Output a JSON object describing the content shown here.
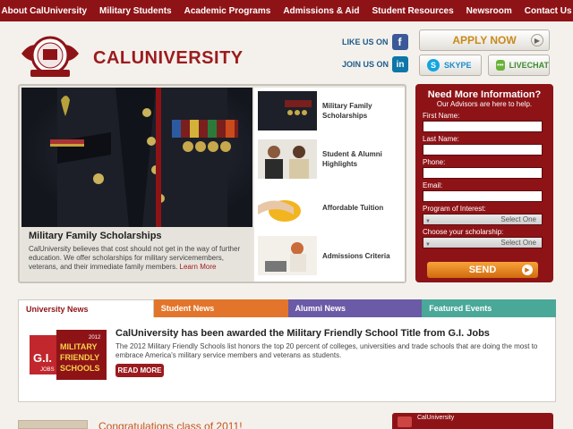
{
  "nav": [
    "About CalUniversity",
    "Military Students",
    "Academic Programs",
    "Admissions & Aid",
    "Student Resources",
    "Newsroom",
    "Contact Us"
  ],
  "brand": "CALUNIVERSITY",
  "social": {
    "facebook": "LIKE US ON",
    "linkedin": "JOIN US ON"
  },
  "buttons": {
    "apply": "APPLY NOW",
    "skype": "SKYPE",
    "livechat": "LIVECHAT"
  },
  "feature": {
    "title": "Military Family Scholarships",
    "text": "CalUniversity believes that cost should not get in the way of further education. We offer scholarships for military servicemembers, veterans, and their immediate family members.",
    "more": "Learn More",
    "items": [
      "Military Family Scholarships",
      "Student & Alumni Highlights",
      "Affordable Tuition",
      "Admissions Criteria"
    ]
  },
  "form": {
    "title": "Need More Information?",
    "subtitle": "Our Advisors are here to help.",
    "first_name": "First Name:",
    "last_name": "Last Name:",
    "phone": "Phone:",
    "email": "Email:",
    "program": "Program of Interest:",
    "scholarship": "Choose your scholarship:",
    "select_one": "Select One",
    "send": "SEND"
  },
  "tabs": [
    "University News",
    "Student News",
    "Alumni News",
    "Featured Events"
  ],
  "news": {
    "title": "CalUniversity has been awarded the Military Friendly School Title from G.I. Jobs",
    "body": "The 2012 Military Friendly Schools list honors the top 20 percent of colleges, universities and trade schools that are doing the most to embrace America's military service members and veterans as students.",
    "read_more": "READ MORE",
    "badge_gi": "G.I.",
    "badge_jobs": "JOBS",
    "badge_year": "2012",
    "badge_line1": "MILITARY",
    "badge_line2": "FRIENDLY",
    "badge_line3": "SCHOOLS"
  },
  "bottom": {
    "congrats": "Congratulations class of 2011!",
    "card_label": "CalUniversity"
  },
  "colors": {
    "brand_red": "#8e1317",
    "tab_orange": "#e2752b",
    "tab_purple": "#6b5aa6",
    "tab_teal": "#4aa898"
  }
}
